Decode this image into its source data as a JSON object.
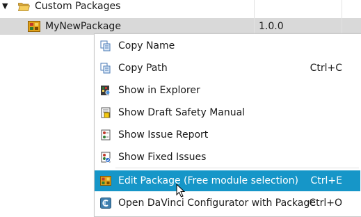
{
  "tree": {
    "folder": {
      "label": "Custom Packages",
      "icon": "folder-open-icon"
    },
    "package": {
      "label": "MyNewPackage",
      "version": "1.0.0",
      "icon": "package-icon"
    }
  },
  "context_menu": {
    "items": [
      {
        "label": "Copy Name",
        "shortcut": "",
        "icon": "copy-icon"
      },
      {
        "label": "Copy Path",
        "shortcut": "Ctrl+C",
        "icon": "copy-icon"
      },
      {
        "label": "Show in Explorer",
        "shortcut": "",
        "icon": "explorer-icon"
      },
      {
        "label": "Show Draft Safety Manual",
        "shortcut": "",
        "icon": "manual-icon"
      },
      {
        "label": "Show Issue Report",
        "shortcut": "",
        "icon": "report-icon"
      },
      {
        "label": "Show Fixed Issues",
        "shortcut": "",
        "icon": "fixed-issues-icon"
      },
      {
        "label": "Edit Package (Free module selection)",
        "shortcut": "Ctrl+E",
        "icon": "edit-package-icon",
        "highlighted": true
      },
      {
        "label": "Open DaVinci Configurator with Package",
        "shortcut": "Ctrl+O",
        "icon": "configurator-icon"
      }
    ]
  },
  "colors": {
    "highlight": "#1696c8",
    "selected_row": "#d9d9d9"
  }
}
